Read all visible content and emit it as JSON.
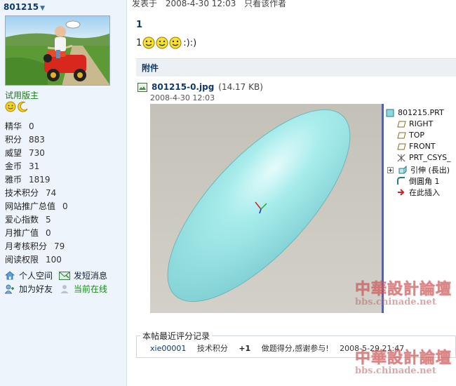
{
  "user": {
    "name": "801215",
    "group": "试用版主",
    "stats": [
      {
        "label": "精华",
        "value": "0"
      },
      {
        "label": "积分",
        "value": "883"
      },
      {
        "label": "威望",
        "value": "730"
      },
      {
        "label": "金币",
        "value": "31"
      },
      {
        "label": "雅币",
        "value": "1819"
      },
      {
        "label": "技术积分",
        "value": "74"
      },
      {
        "label": "网站推广总值",
        "value": "0"
      },
      {
        "label": "爱心指数",
        "value": "5"
      },
      {
        "label": "月推广值",
        "value": "0"
      },
      {
        "label": "月考核积分",
        "value": "79"
      },
      {
        "label": "阅读权限",
        "value": "100"
      }
    ],
    "actions": {
      "space": "个人空间",
      "message": "发短消息",
      "friend": "加为好友",
      "online": "当前在线"
    }
  },
  "post": {
    "posted_label": "发表于",
    "posted_date": "2008-4-30 12:03",
    "author_only": "只看该作者",
    "title": "1",
    "body_prefix": "1",
    "body_suffix": ":):)"
  },
  "attachment": {
    "header": "附件",
    "filename": "801215-0.jpg",
    "size": "(14.17 KB)",
    "date": "2008-4-30 12:03"
  },
  "model_tree": {
    "items": [
      "801215.PRT",
      "RIGHT",
      "TOP",
      "FRONT",
      "PRT_CSYS_",
      "引伸 (長出)",
      "倒圓角 1",
      "在此插入"
    ]
  },
  "rating": {
    "legend": "本帖最近评分记录",
    "user": "xie00001",
    "type": "技术积分",
    "amount": "+1",
    "reason": "做题得分,感谢参与!",
    "time": "2008-5-29 21:47"
  },
  "watermark": {
    "cn": "中華設計論壇",
    "url": "bbs.chinade.net"
  },
  "colors": {
    "link": "#0d3a6b",
    "ellipsoid": "#9eeaea",
    "cad_bg": "#c8c6bc",
    "online": "#1a8a1a"
  }
}
